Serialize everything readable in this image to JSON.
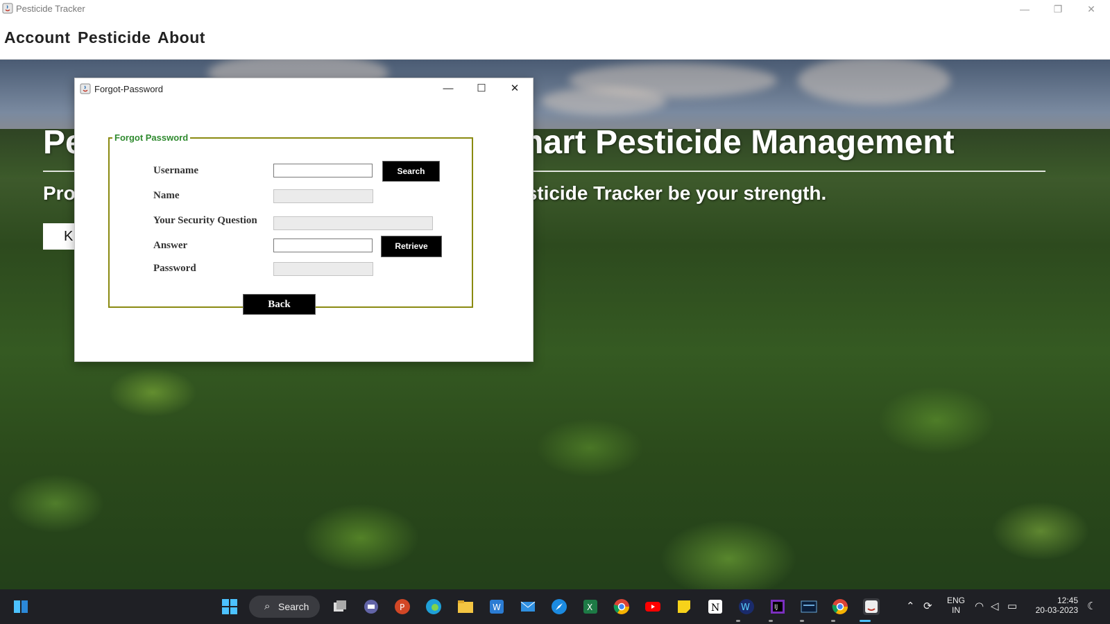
{
  "window": {
    "title": "Pesticide Tracker",
    "controls": {
      "minimize": "—",
      "restore": "❐",
      "close": "✕"
    }
  },
  "menu": {
    "items": [
      {
        "label": "Account"
      },
      {
        "label": "Pesticide"
      },
      {
        "label": "About"
      }
    ]
  },
  "hero": {
    "title_left": "Pe",
    "title_right": "mart Pesticide Management",
    "subtitle_left": "Pro",
    "subtitle_right": "sticide Tracker be your strength.",
    "button_label": "K"
  },
  "dialog": {
    "title": "Forgot-Password",
    "controls": {
      "minimize": "—",
      "maximize": "☐",
      "close": "✕"
    },
    "group_title": "Forgot Password",
    "fields": {
      "username": {
        "label": "Username",
        "value": ""
      },
      "name": {
        "label": "Name",
        "value": ""
      },
      "security_question": {
        "label": "Your Security Question",
        "value": ""
      },
      "answer": {
        "label": "Answer",
        "value": ""
      },
      "password": {
        "label": "Password",
        "value": ""
      }
    },
    "buttons": {
      "search": "Search",
      "retrieve": "Retrieve",
      "back": "Back"
    }
  },
  "taskbar": {
    "search_label": "Search",
    "search_icon": "⌕",
    "lang_top": "ENG",
    "lang_bottom": "IN",
    "time": "12:45",
    "date": "20-03-2023",
    "icons": [
      "start-icon",
      "task-view-icon",
      "teams-chat-icon",
      "powerpoint-icon",
      "edge-icon",
      "file-explorer-icon",
      "word-icon",
      "mail-icon",
      "safari-icon",
      "excel-icon",
      "chrome-icon",
      "youtube-icon",
      "sticky-notes-icon",
      "notion-icon",
      "webex-icon",
      "intellij-icon",
      "mysql-workbench-icon",
      "chrome-profile-icon",
      "java-app-icon"
    ],
    "accent_colors": {
      "start": "#4cc2ff",
      "powerpoint": "#d24726",
      "edge": "#1fa0d8",
      "explorer": "#f4c542",
      "word": "#2b7cd3",
      "excel": "#1d7a45",
      "youtube": "#ff0000",
      "sticky": "#f7d21a",
      "intellij": "#7b2fbf"
    }
  },
  "colors": {
    "group_border": "#8a8a10",
    "group_title": "#2f8a2f",
    "button_bg": "#000000"
  }
}
